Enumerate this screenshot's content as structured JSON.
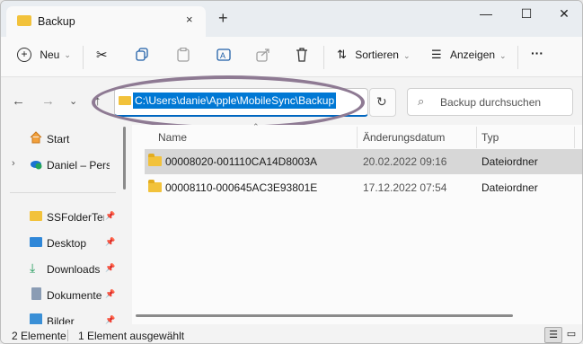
{
  "tab": {
    "title": "Backup",
    "close_icon": "×",
    "new_tab_icon": "+"
  },
  "window_controls": {
    "minimize": "—",
    "maximize": "☐",
    "close": "✕"
  },
  "toolbar": {
    "new_label": "Neu",
    "sort_label": "Sortieren",
    "view_label": "Anzeigen",
    "more_label": "···"
  },
  "address": {
    "path": "C:\\Users\\danie\\Apple\\MobileSync\\Backup",
    "search_placeholder": "Backup durchsuchen"
  },
  "nav": {
    "items": [
      {
        "label": "Start",
        "icon": "home-icon"
      },
      {
        "label": "Daniel – Persönl",
        "icon": "onedrive-icon"
      },
      {
        "label": "SSFolderTem",
        "icon": "folder-icon"
      },
      {
        "label": "Desktop",
        "icon": "desktop-icon"
      },
      {
        "label": "Downloads",
        "icon": "download-icon"
      },
      {
        "label": "Dokumente",
        "icon": "document-icon"
      },
      {
        "label": "Bilder",
        "icon": "pictures-icon"
      }
    ]
  },
  "columns": {
    "name": "Name",
    "date": "Änderungsdatum",
    "type": "Typ"
  },
  "files": [
    {
      "name": "00008020-001110CA14D8003A",
      "date": "20.02.2022 09:16",
      "type": "Dateiordner",
      "selected": true
    },
    {
      "name": "00008110-000645AC3E93801E",
      "date": "17.12.2022 07:54",
      "type": "Dateiordner",
      "selected": false
    }
  ],
  "status": {
    "count": "2 Elemente",
    "selection": "1 Element ausgewählt"
  },
  "colors": {
    "accent": "#0078d4",
    "folder": "#f2c23b",
    "selection_row": "#d7d7d7",
    "highlight_ring": "#8e7a93"
  }
}
